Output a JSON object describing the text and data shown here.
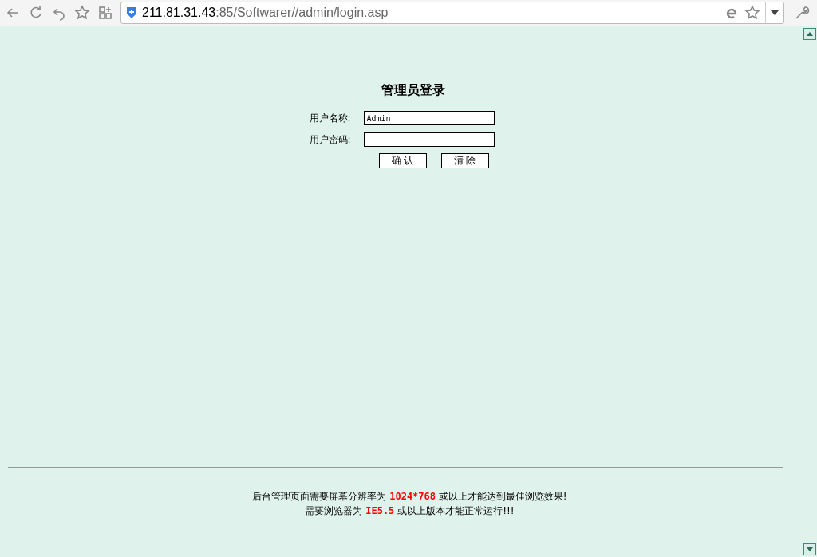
{
  "browser": {
    "address": {
      "host": "211.81.31.43",
      "rest": ":85/Softwarer//admin/login.asp"
    }
  },
  "login": {
    "title": "管理员登录",
    "fields": [
      {
        "label": "用户名称:",
        "value": "Admin",
        "kind": "text"
      },
      {
        "label": "用户密码:",
        "kind": "password"
      }
    ],
    "buttons": [
      "确 认",
      "清 除"
    ]
  },
  "footer": [
    "后台管理页面需要屏幕分辨率为 **1024*768** 或以上才能达到最佳浏览效果!",
    "需要浏览器为 **IE5.5** 或以上版本才能正常运行!!!"
  ]
}
